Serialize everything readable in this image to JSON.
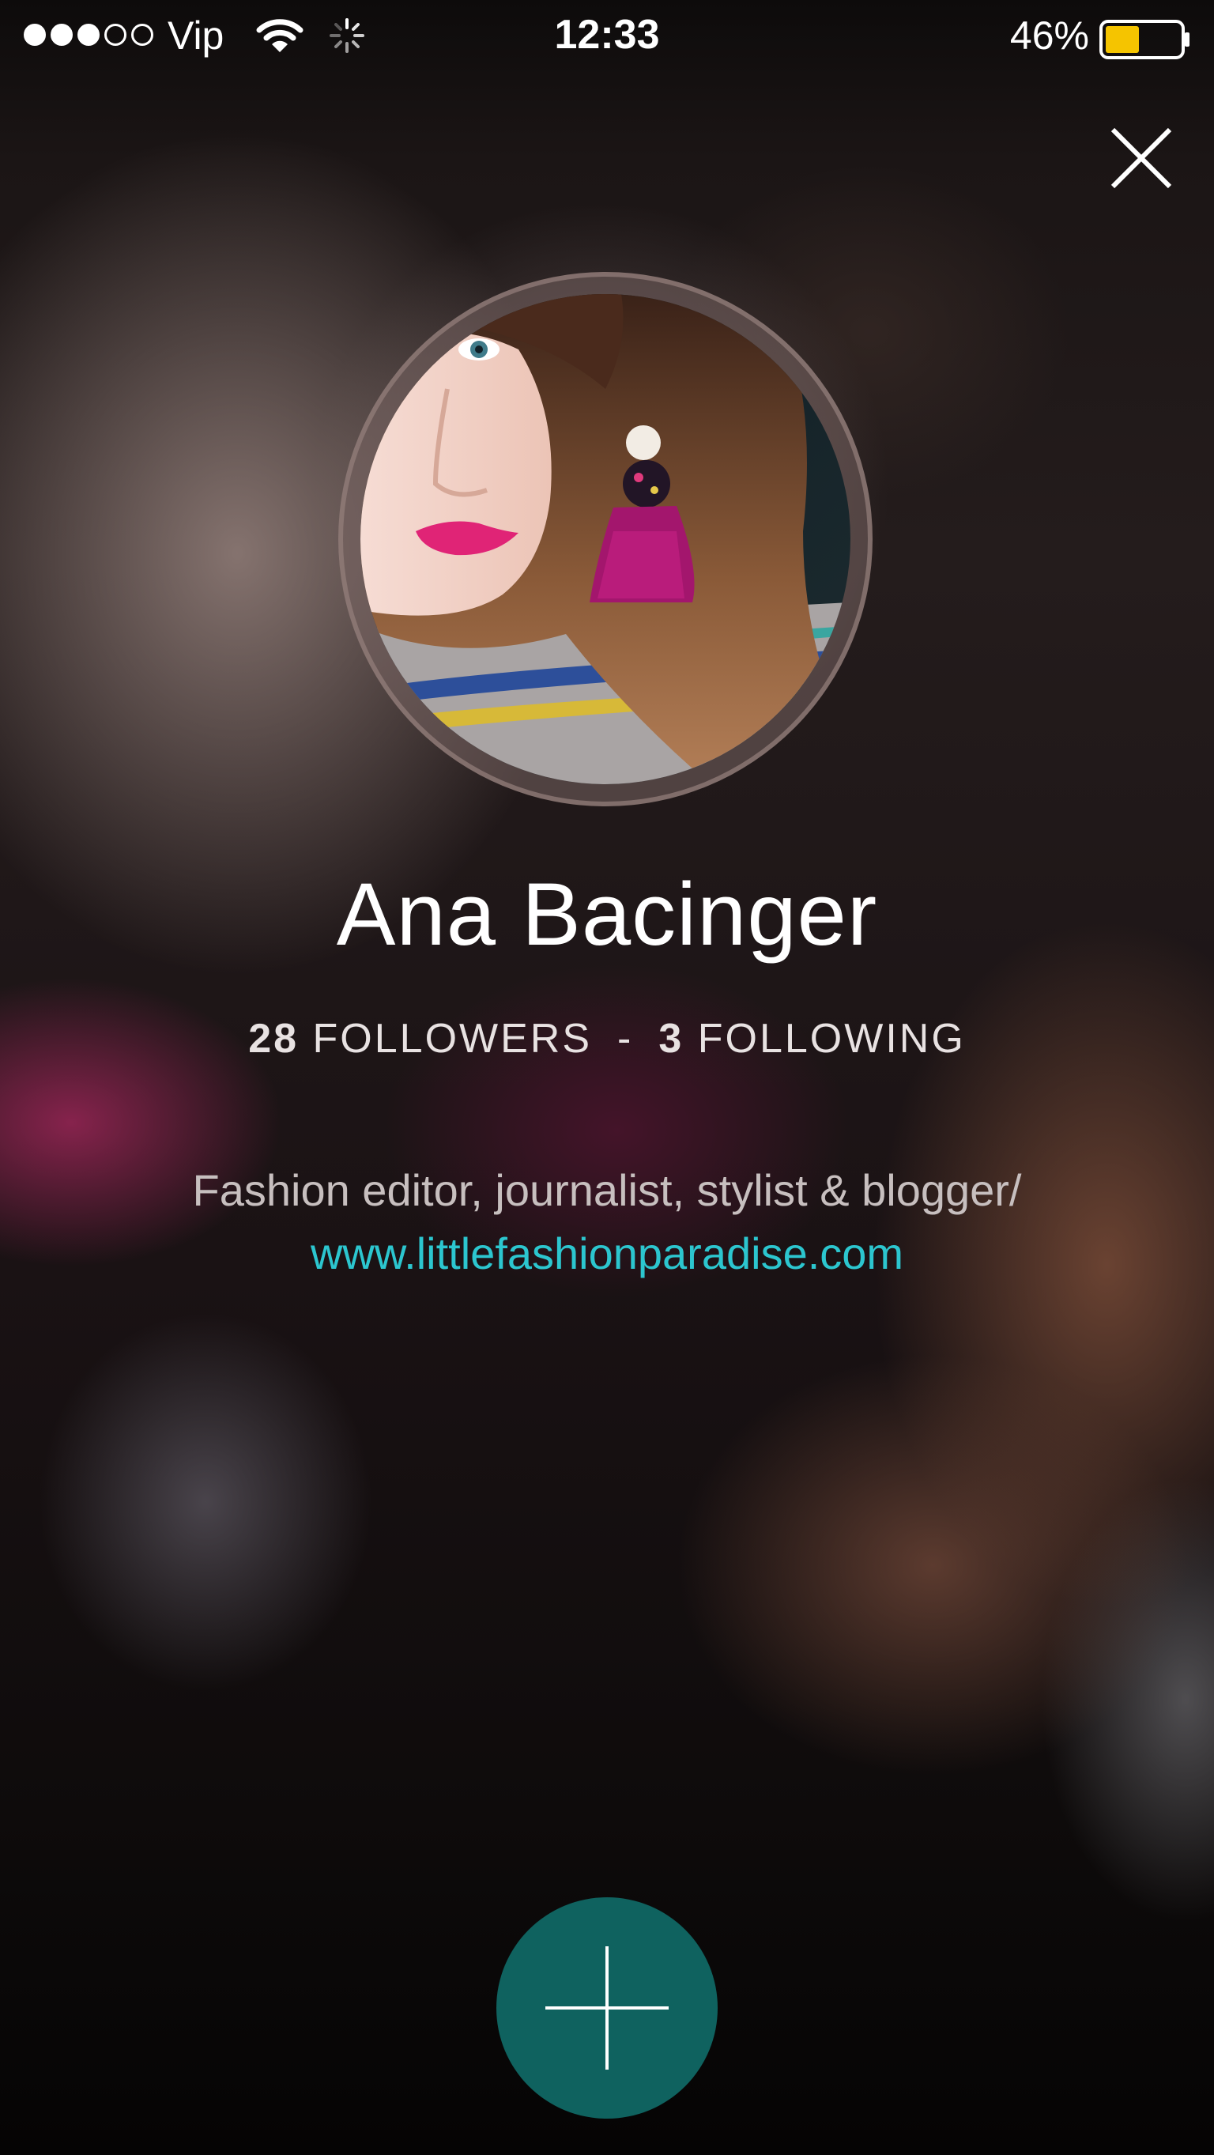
{
  "status_bar": {
    "carrier": "Vip",
    "time": "12:33",
    "battery_percent": "46%",
    "battery_level": 0.46,
    "signal_bars_filled": 3,
    "signal_bars_total": 5,
    "battery_color": "#f5c400"
  },
  "profile": {
    "name": "Ana Bacinger",
    "followers_count": "28",
    "followers_label": "FOLLOWERS",
    "separator": "-",
    "following_count": "3",
    "following_label": "FOLLOWING",
    "bio": "Fashion editor, journalist, stylist & blogger/",
    "website": "www.littlefashionparadise.com"
  },
  "colors": {
    "link": "#2cc6cf",
    "fab_background": "#0f625f"
  },
  "icons": {
    "close": "close-icon",
    "add": "plus-icon",
    "wifi": "wifi-icon",
    "activity": "loading-spinner-icon",
    "battery": "battery-icon"
  }
}
